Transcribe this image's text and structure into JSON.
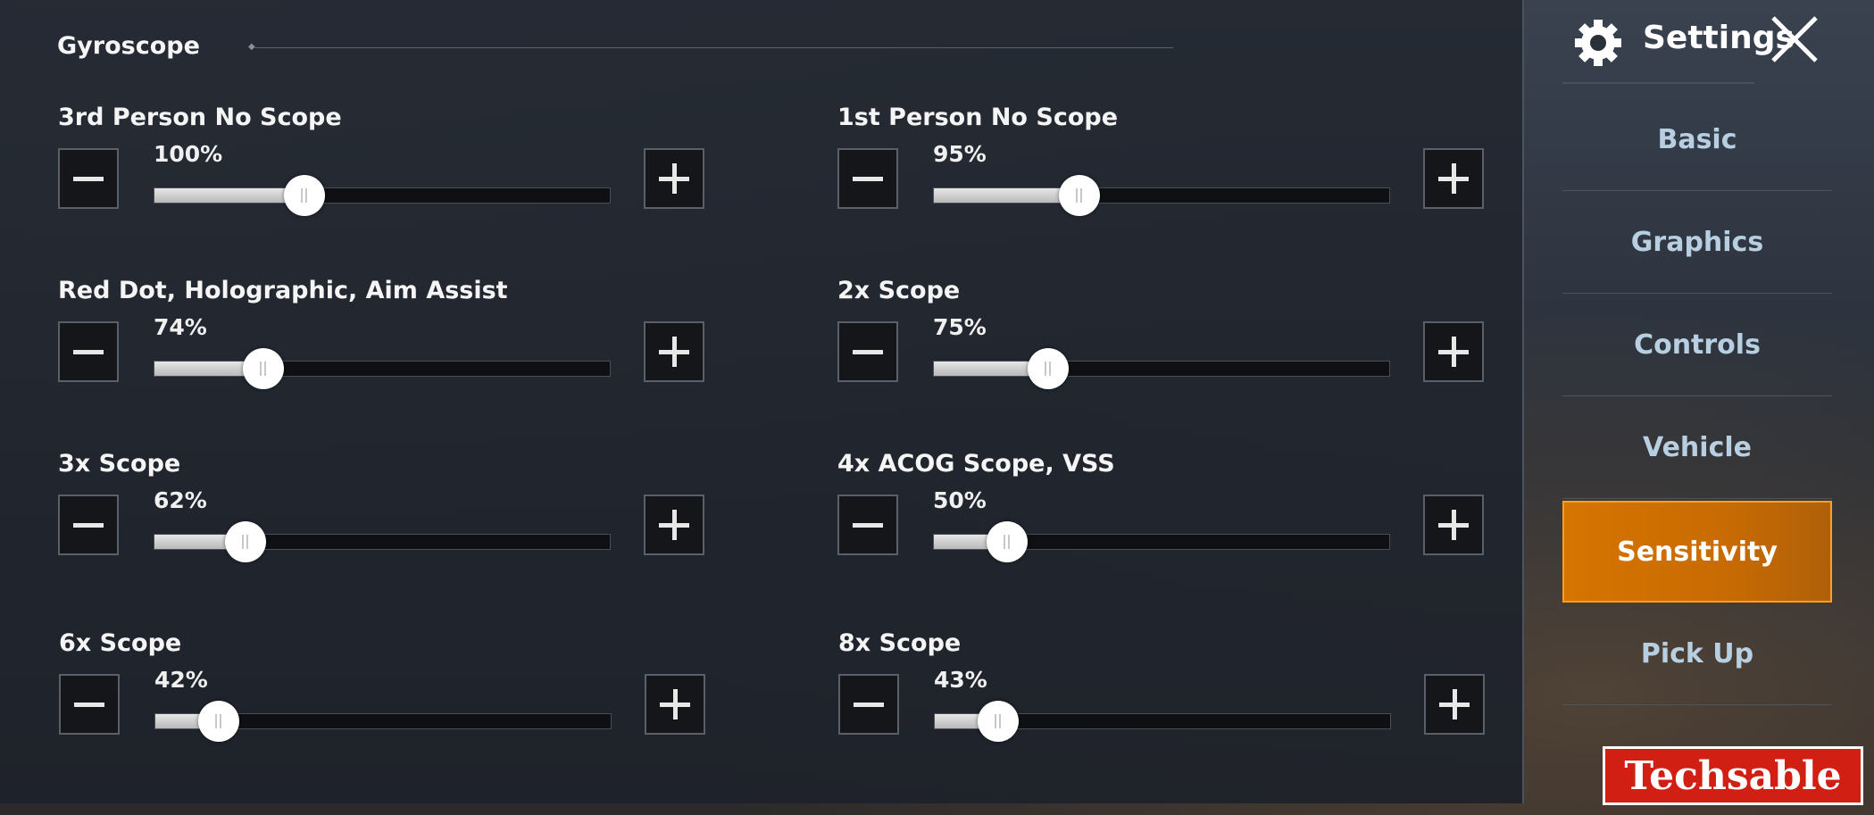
{
  "section": {
    "title": "Gyroscope"
  },
  "sensitivity": {
    "settings": [
      {
        "label": "3rd Person No Scope",
        "value_text": "100%",
        "fill": 0.33
      },
      {
        "label": "1st Person No Scope",
        "value_text": "95%",
        "fill": 0.32
      },
      {
        "label": "Red Dot, Holographic, Aim Assist",
        "value_text": "74%",
        "fill": 0.24
      },
      {
        "label": "2x Scope",
        "value_text": "75%",
        "fill": 0.25
      },
      {
        "label": "3x Scope",
        "value_text": "62%",
        "fill": 0.2
      },
      {
        "label": "4x ACOG Scope, VSS",
        "value_text": "50%",
        "fill": 0.16
      },
      {
        "label": "6x Scope",
        "value_text": "42%",
        "fill": 0.14
      },
      {
        "label": "8x Scope",
        "value_text": "43%",
        "fill": 0.14
      }
    ]
  },
  "sidebar": {
    "title": "Settings",
    "tabs": [
      {
        "label": "Basic",
        "active": false
      },
      {
        "label": "Graphics",
        "active": false
      },
      {
        "label": "Controls",
        "active": false
      },
      {
        "label": "Vehicle",
        "active": false
      },
      {
        "label": "Sensitivity",
        "active": true
      },
      {
        "label": "Pick Up",
        "active": false
      }
    ]
  },
  "watermark": {
    "text": "Techsable"
  },
  "colors": {
    "accent": "#d67400",
    "tab_text": "#b7cfe1"
  },
  "icons": {
    "settings": "gear-icon",
    "close": "close-icon",
    "decrease": "minus-icon",
    "increase": "plus-icon"
  }
}
